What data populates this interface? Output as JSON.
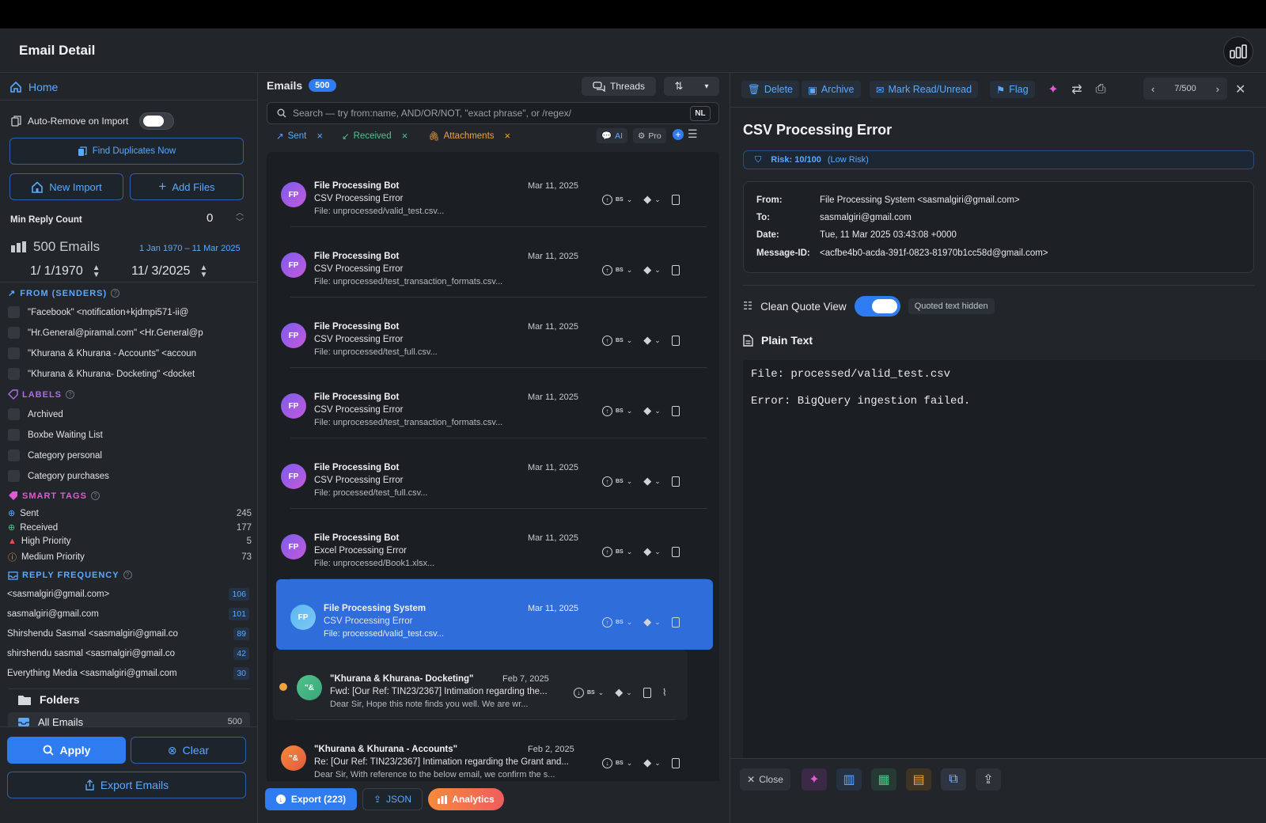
{
  "header": {
    "title": "Email Detail"
  },
  "sidebar": {
    "home": "Home",
    "auto_remove": "Auto-Remove on Import",
    "find_dupes": "Find Duplicates Now",
    "new_import": "New Import",
    "add_files": "Add Files",
    "min_reply_label": "Min Reply Count",
    "min_reply_value": "0",
    "email_count": "500 Emails",
    "date_range": "1 Jan 1970 – 11 Mar 2025",
    "date_from": "1/  1/1970",
    "date_to": "11/  3/2025",
    "from_header": "FROM (SENDERS)",
    "senders": [
      "\"Facebook\" <notification+kjdmpi571-ii@",
      "\"Hr.General@piramal.com\" <Hr.General@p",
      "\"Khurana & Khurana - Accounts\" <accoun",
      "\"Khurana & Khurana- Docketing\" <docket"
    ],
    "labels_header": "LABELS",
    "labels": [
      "Archived",
      "Boxbe Waiting List",
      "Category personal",
      "Category purchases"
    ],
    "smart_tags_header": "SMART TAGS",
    "smart_tags": [
      {
        "label": "Sent",
        "count": "245"
      },
      {
        "label": "Received",
        "count": "177"
      },
      {
        "label": "High Priority",
        "count": "5"
      },
      {
        "label": "Medium Priority",
        "count": "73"
      }
    ],
    "reply_freq_header": "REPLY FREQUENCY",
    "reply_freq": [
      {
        "label": "<sasmalgiri@gmail.com>",
        "count": "106"
      },
      {
        "label": "sasmalgiri@gmail.com",
        "count": "101"
      },
      {
        "label": "Shirshendu Sasmal <sasmalgiri@gmail.co",
        "count": "89"
      },
      {
        "label": "shirshendu sasmal <sasmalgiri@gmail.co",
        "count": "42"
      },
      {
        "label": "Everything Media <sasmalgiri@gmail.com",
        "count": "30"
      }
    ],
    "folders": "Folders",
    "all_emails": "All Emails",
    "all_emails_count": "500",
    "apply": "Apply",
    "clear": "Clear",
    "export_emails": "Export Emails"
  },
  "middle": {
    "title": "Emails",
    "count": "500",
    "threads": "Threads",
    "search_placeholder": "Search — try from:name, AND/OR/NOT, \"exact phrase\", or /regex/",
    "nl": "NL",
    "chips": [
      "Sent",
      "Received",
      "Attachments"
    ],
    "ai": "AI",
    "pro": "Pro",
    "tag_code": "BS",
    "emails": [
      {
        "initials": "FP",
        "sender": "File Processing Bot",
        "subject": "CSV Processing Error",
        "preview": "File: unprocessed/valid_test.csv...",
        "date": "Mar 11, 2025"
      },
      {
        "initials": "FP",
        "sender": "File Processing Bot",
        "subject": "CSV Processing Error",
        "preview": "File: unprocessed/test_transaction_formats.csv...",
        "date": "Mar 11, 2025"
      },
      {
        "initials": "FP",
        "sender": "File Processing Bot",
        "subject": "CSV Processing Error",
        "preview": "File: unprocessed/test_full.csv...",
        "date": "Mar 11, 2025"
      },
      {
        "initials": "FP",
        "sender": "File Processing Bot",
        "subject": "CSV Processing Error",
        "preview": "File: unprocessed/test_transaction_formats.csv...",
        "date": "Mar 11, 2025"
      },
      {
        "initials": "FP",
        "sender": "File Processing Bot",
        "subject": "CSV Processing Error",
        "preview": "File: processed/test_full.csv...",
        "date": "Mar 11, 2025"
      },
      {
        "initials": "FP",
        "sender": "File Processing Bot",
        "subject": "Excel Processing Error",
        "preview": "File: unprocessed/Book1.xlsx...",
        "date": "Mar 11, 2025"
      },
      {
        "initials": "FP",
        "sender": "File Processing System",
        "subject": "CSV Processing Error",
        "preview": "File: processed/valid_test.csv...",
        "date": "Mar 11, 2025"
      },
      {
        "initials": "\"&",
        "sender": "\"Khurana & Khurana- Docketing\"",
        "subject": "Fwd: [Our Ref: TIN23/2367] Intimation regarding the...",
        "preview": "Dear Sir,    Hope this note finds you well.    We are wr...",
        "date": "Feb 7, 2025"
      },
      {
        "initials": "\"&",
        "sender": "\"Khurana & Khurana - Accounts\"",
        "subject": "Re: [Our Ref: TIN23/2367] Intimation regarding the Grant and...",
        "preview": "Dear Sir,  With reference to the below email, we confirm the s...",
        "date": "Feb 2, 2025"
      }
    ],
    "export": "Export (223)",
    "json": "JSON",
    "analytics": "Analytics"
  },
  "detail": {
    "delete": "Delete",
    "archive": "Archive",
    "mark": "Mark Read/Unread",
    "flag": "Flag",
    "position": "7/500",
    "title": "CSV Processing Error",
    "risk": "Risk: 10/100",
    "risk_level": "(Low Risk)",
    "from_k": "From:",
    "from_v": "File Processing System <sasmalgiri@gmail.com>",
    "to_k": "To:",
    "to_v": "sasmalgiri@gmail.com",
    "date_k": "Date:",
    "date_v": "Tue, 11 Mar 2025 03:43:08 +0000",
    "msgid_k": "Message-ID:",
    "msgid_v": "<acfbe4b0-acda-391f-0823-81970b1cc58d@gmail.com>",
    "clean_quote": "Clean Quote View",
    "quoted_hidden": "Quoted text hidden",
    "plain_text": "Plain Text",
    "body_lines": [
      "File: processed/valid_test.csv",
      "Error: BigQuery ingestion failed."
    ],
    "close": "Close"
  },
  "colors": {
    "accent": "#2f7bf0",
    "link": "#5aa9ff",
    "purple": "#b06be8",
    "pink": "#e05ad2"
  }
}
